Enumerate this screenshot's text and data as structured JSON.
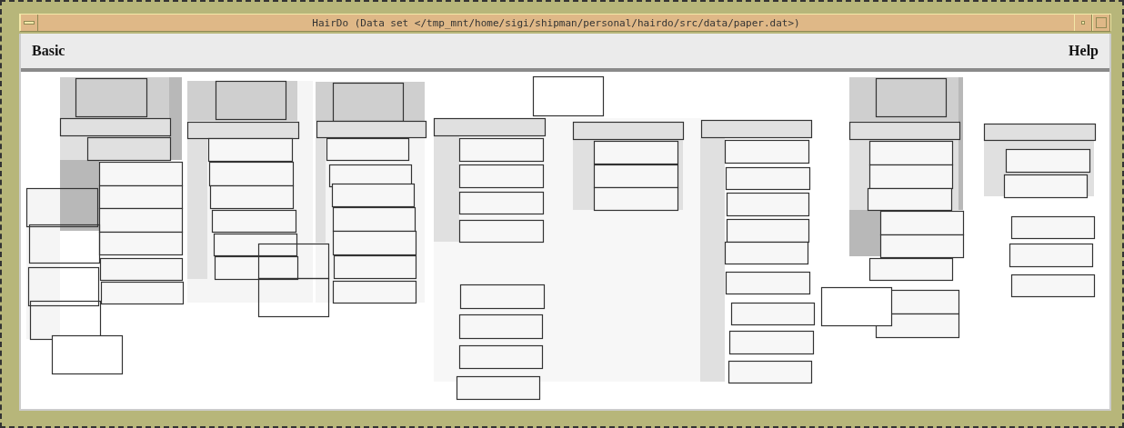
{
  "window": {
    "title": "HairDo (Data set </tmp_mnt/home/sigi/shipman/personal/hairdo/src/data/paper.dat>)"
  },
  "menu_bar": {
    "items": [
      {
        "label": "Basic"
      },
      {
        "label": "Help"
      }
    ]
  }
}
